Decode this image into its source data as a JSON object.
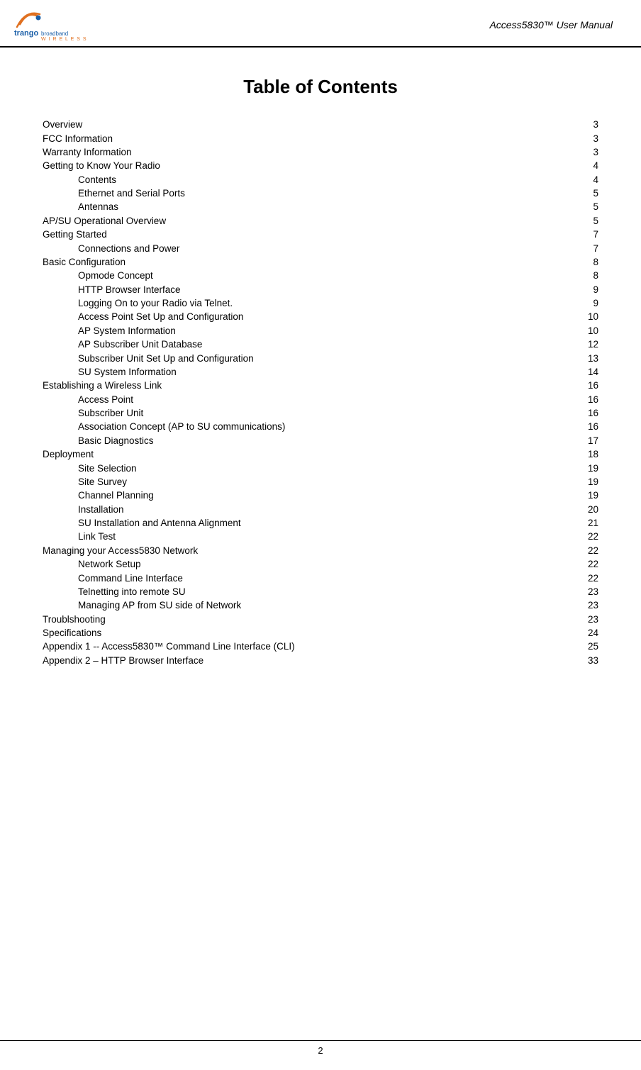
{
  "header": {
    "logo_alt": "Trango Broadband Wireless",
    "title": "Access5830™ User Manual"
  },
  "toc": {
    "heading": "Table of Contents",
    "entries": [
      {
        "label": "Overview",
        "page": "3",
        "indent": false
      },
      {
        "label": "FCC Information",
        "page": "3",
        "indent": false
      },
      {
        "label": "Warranty Information",
        "page": "3",
        "indent": false
      },
      {
        "label": "Getting to Know Your Radio",
        "page": "4",
        "indent": false
      },
      {
        "label": "Contents",
        "page": "4",
        "indent": true
      },
      {
        "label": "Ethernet and Serial Ports",
        "page": "5",
        "indent": true
      },
      {
        "label": "Antennas",
        "page": "5",
        "indent": true
      },
      {
        "label": "AP/SU Operational Overview",
        "page": "5",
        "indent": false
      },
      {
        "label": "Getting Started",
        "page": "7",
        "indent": false
      },
      {
        "label": "Connections and Power",
        "page": "7",
        "indent": true
      },
      {
        "label": "Basic Configuration",
        "page": "8",
        "indent": false
      },
      {
        "label": "Opmode Concept",
        "page": "8",
        "indent": true
      },
      {
        "label": "HTTP Browser Interface",
        "page": "9",
        "indent": true
      },
      {
        "label": "Logging On to your Radio via Telnet.",
        "page": "9",
        "indent": true
      },
      {
        "label": "Access Point Set Up and Configuration",
        "page": "10",
        "indent": true
      },
      {
        "label": "AP System Information",
        "page": "10",
        "indent": true
      },
      {
        "label": "AP Subscriber Unit Database",
        "page": "12",
        "indent": true
      },
      {
        "label": "Subscriber Unit Set Up and Configuration",
        "page": "13",
        "indent": true
      },
      {
        "label": "SU System Information",
        "page": "14",
        "indent": true
      },
      {
        "label": "Establishing a Wireless Link",
        "page": "16",
        "indent": false
      },
      {
        "label": "Access Point",
        "page": "16",
        "indent": true
      },
      {
        "label": "Subscriber Unit",
        "page": "16",
        "indent": true
      },
      {
        "label": "Association Concept (AP to SU communications)",
        "page": "16",
        "indent": true
      },
      {
        "label": "Basic Diagnostics",
        "page": "17",
        "indent": true
      },
      {
        "label": "Deployment",
        "page": "18",
        "indent": false
      },
      {
        "label": "Site Selection",
        "page": "19",
        "indent": true
      },
      {
        "label": "Site Survey",
        "page": "19",
        "indent": true
      },
      {
        "label": "Channel Planning",
        "page": "19",
        "indent": true
      },
      {
        "label": "Installation",
        "page": "20",
        "indent": true
      },
      {
        "label": "SU Installation and Antenna Alignment",
        "page": "21",
        "indent": true
      },
      {
        "label": "Link Test",
        "page": "22",
        "indent": true
      },
      {
        "label": "Managing your Access5830 Network",
        "page": "22",
        "indent": false
      },
      {
        "label": "Network Setup",
        "page": "22",
        "indent": true
      },
      {
        "label": "Command Line Interface",
        "page": "22",
        "indent": true
      },
      {
        "label": "Telnetting into remote SU",
        "page": "23",
        "indent": true
      },
      {
        "label": "Managing AP from SU side of Network",
        "page": "23",
        "indent": true
      },
      {
        "label": "Troublshooting",
        "page": "23",
        "indent": false
      },
      {
        "label": "Specifications",
        "page": "24",
        "indent": false
      },
      {
        "label": "Appendix 1 -- Access5830™ Command Line Interface (CLI)",
        "page": "25",
        "indent": false
      },
      {
        "label": "Appendix 2 – HTTP Browser Interface",
        "page": "33",
        "indent": false
      }
    ]
  },
  "footer": {
    "page_number": "2"
  }
}
